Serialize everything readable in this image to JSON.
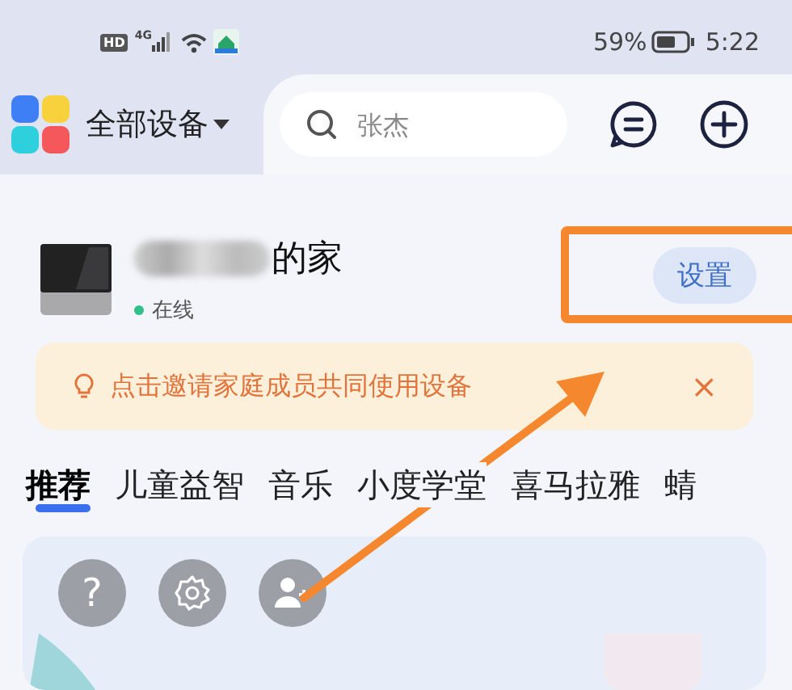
{
  "status_bar": {
    "badges": [
      "HD",
      "4G"
    ],
    "battery": "59%",
    "time": "5:22"
  },
  "header": {
    "title": "全部设备",
    "search": {
      "placeholder": "张杰"
    }
  },
  "home": {
    "name": "的家",
    "status": "在线",
    "online": true,
    "settings_button": "设置"
  },
  "banner": {
    "text": "点击邀请家庭成员共同使用设备",
    "close": "×"
  },
  "tabs": [
    {
      "label": "推荐",
      "selected": true
    },
    {
      "label": "儿童益智",
      "selected": false
    },
    {
      "label": "音乐",
      "selected": false
    },
    {
      "label": "小度学堂",
      "selected": false
    },
    {
      "label": "喜马拉雅",
      "selected": false
    },
    {
      "label": "蜻",
      "selected": false
    }
  ],
  "quick_actions": [
    {
      "kind": "help",
      "glyph": "?"
    },
    {
      "kind": "settings"
    },
    {
      "kind": "add_member"
    }
  ],
  "annotations": {
    "highlight_box": true,
    "arrow": true
  }
}
